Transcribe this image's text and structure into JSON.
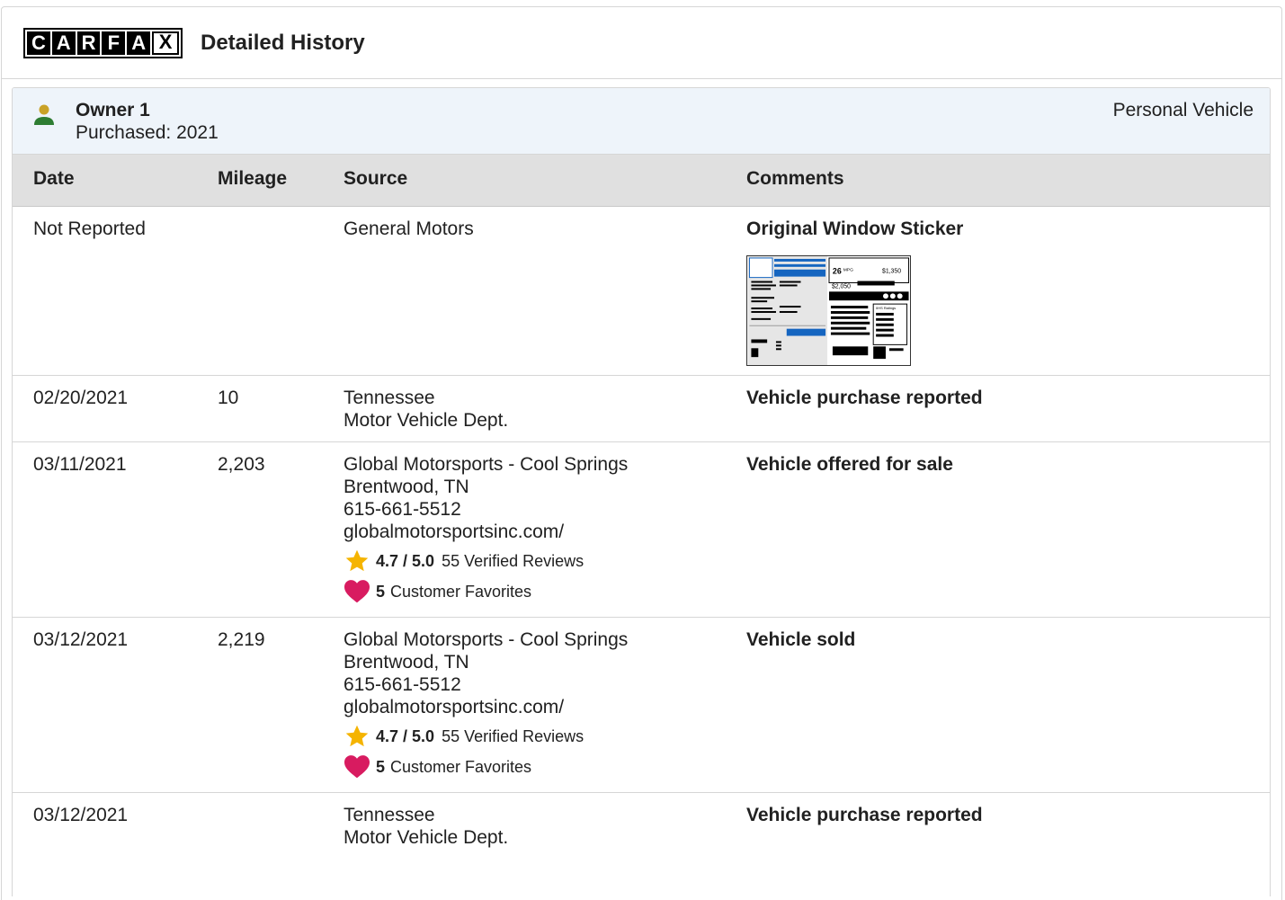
{
  "header": {
    "logo_letters": [
      "C",
      "A",
      "R",
      "F",
      "A",
      "X"
    ],
    "title": "Detailed History"
  },
  "owner": {
    "name": "Owner 1",
    "purchased": "Purchased: 2021",
    "type": "Personal Vehicle"
  },
  "table": {
    "headers": [
      "Date",
      "Mileage",
      "Source",
      "Comments"
    ],
    "rows": [
      {
        "date": "Not Reported",
        "mileage": "",
        "source": [
          "General Motors"
        ],
        "comment": "Original Window Sticker",
        "has_sticker": true
      },
      {
        "date": "02/20/2021",
        "mileage": "10",
        "source": [
          "Tennessee",
          "Motor Vehicle Dept."
        ],
        "comment": "Vehicle purchase reported"
      },
      {
        "date": "03/11/2021",
        "mileage": "2,203",
        "source": [
          "Global Motorsports - Cool Springs",
          "Brentwood, TN",
          "615-661-5512",
          "globalmotorsportsinc.com/"
        ],
        "rating": "4.7 / 5.0",
        "reviews": "55 Verified Reviews",
        "favorites_count": "5",
        "favorites_label": "Customer Favorites",
        "comment": "Vehicle offered for sale"
      },
      {
        "date": "03/12/2021",
        "mileage": "2,219",
        "source": [
          "Global Motorsports - Cool Springs",
          "Brentwood, TN",
          "615-661-5512",
          "globalmotorsportsinc.com/"
        ],
        "rating": "4.7 / 5.0",
        "reviews": "55 Verified Reviews",
        "favorites_count": "5",
        "favorites_label": "Customer Favorites",
        "comment": "Vehicle sold"
      },
      {
        "date": "03/12/2021",
        "mileage": "",
        "source": [
          "Tennessee",
          "Motor Vehicle Dept."
        ],
        "comment": "Vehicle purchase reported"
      }
    ]
  },
  "sticker": {
    "mpg": "26",
    "mpg_unit": "MPG",
    "savings": "$1,350",
    "cost": "$2,050",
    "iihs": "IIHS Ratings"
  },
  "colors": {
    "owner_bar": "#eef4fa",
    "table_header": "#e0e0e0",
    "star": "#f5b400",
    "heart": "#d81b60",
    "person_head": "#c9a227",
    "person_body": "#2e7d32"
  }
}
